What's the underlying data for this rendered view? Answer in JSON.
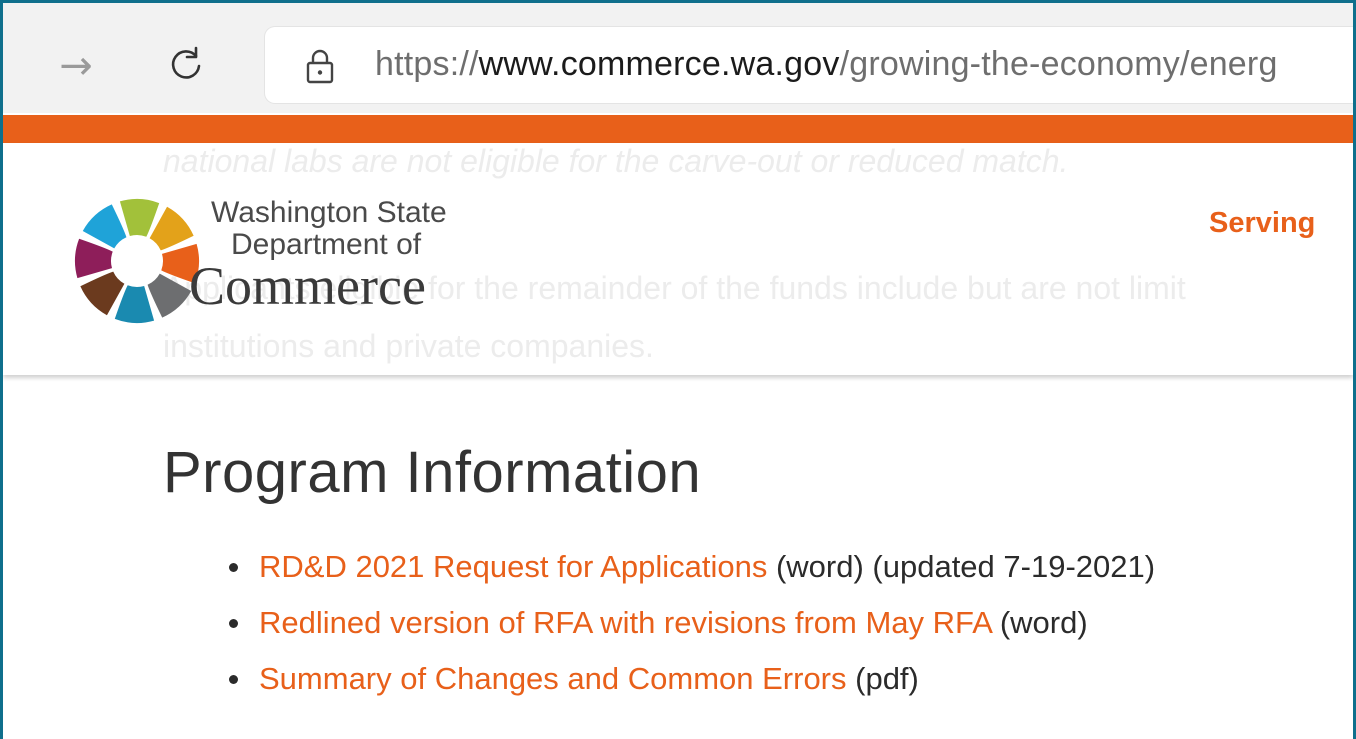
{
  "browser": {
    "url_scheme": "https://",
    "url_domain": "www.commerce.wa.gov",
    "url_path": "/growing-the-economy/energ"
  },
  "header": {
    "ghost_line1": "national labs are not eligible for the carve-out or reduced match.",
    "ghost_line2": "Applicants eligible for the remainder of the funds include but are not limit",
    "ghost_line3": "institutions and private companies.",
    "logo_line1": "Washington State",
    "logo_line2": "Department of",
    "logo_line3": "Commerce",
    "nav_label": "Serving"
  },
  "content": {
    "title": "Program Information",
    "items": [
      {
        "link": "RD&D 2021 Request for Applications",
        "suffix": " (word) (updated 7-19-2021)"
      },
      {
        "link": "Redlined version of RFA with revisions from May RFA",
        "suffix": " (word)"
      },
      {
        "link": "Summary of Changes and Common Errors",
        "suffix": " (pdf)"
      }
    ]
  },
  "colors": {
    "accent": "#e8601a",
    "frame": "#0f6f8c",
    "logo_petals": [
      "#a2c13a",
      "#e3a21a",
      "#e8601a",
      "#6d6e70",
      "#1a8ab0",
      "#6b3a1e",
      "#8e1e5a",
      "#1fa3d8"
    ]
  },
  "icons": {
    "forward": "forward-arrow-icon",
    "reload": "reload-icon",
    "lock": "lock-icon",
    "logo": "commerce-logo-icon"
  }
}
